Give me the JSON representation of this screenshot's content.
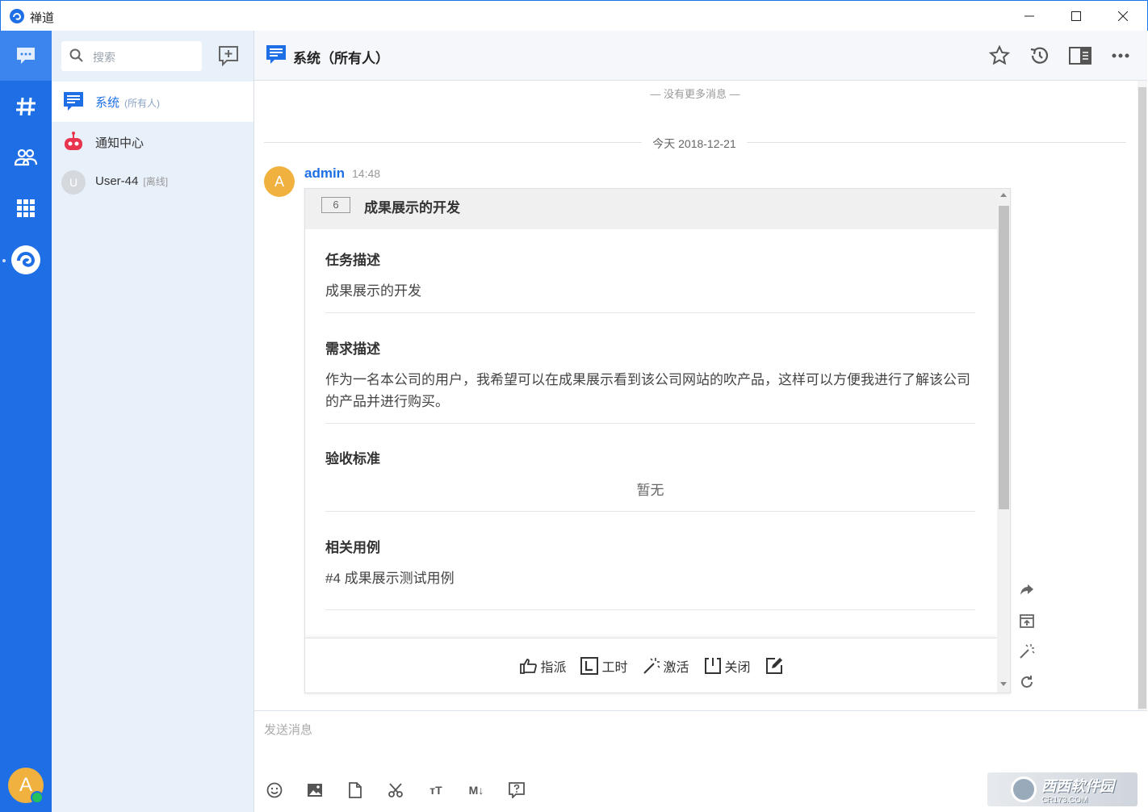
{
  "window": {
    "title": "禅道"
  },
  "nav": {
    "avatar_letter": "A"
  },
  "sidebar": {
    "search_placeholder": "搜索",
    "chats": [
      {
        "name": "系统",
        "sub": "(所有人)"
      },
      {
        "name": "通知中心",
        "sub": ""
      },
      {
        "name": "User-44",
        "sub": "[离线]",
        "avatar_letter": "U"
      }
    ]
  },
  "header": {
    "title": "系统（所有人）"
  },
  "messages": {
    "no_more": "— 没有更多消息 —",
    "date": "今天 2018-12-21",
    "items": [
      {
        "sender": "admin",
        "avatar_letter": "A",
        "time": "14:48",
        "card": {
          "id": "6",
          "title": "成果展示的开发",
          "sections": [
            {
              "title": "任务描述",
              "text": "成果展示的开发"
            },
            {
              "title": "需求描述",
              "text": " 作为一名本公司的用户，我希望可以在成果展示看到该公司网站的吹产品，这样可以方便我进行了解该公司的产品并进行购买。"
            },
            {
              "title": "验收标准",
              "text": "暂无"
            },
            {
              "title": "相关用例",
              "text": "#4 成果展示测试用例"
            }
          ],
          "actions": [
            "指派",
            "工时",
            "激活",
            "关闭"
          ]
        }
      }
    ]
  },
  "composer": {
    "placeholder": "发送消息",
    "tools": [
      "emoji-icon",
      "image-icon",
      "file-icon",
      "scissors-icon",
      "font-size-icon",
      "markdown-icon",
      "help-icon"
    ],
    "markdown_label": "M↓",
    "font_label": "тT"
  },
  "watermark": {
    "text": "西西软件园",
    "sub": "CR173.COM"
  },
  "colors": {
    "brand": "#1e6fe6",
    "accent_orange": "#f0b13e",
    "online": "#22c15e"
  }
}
